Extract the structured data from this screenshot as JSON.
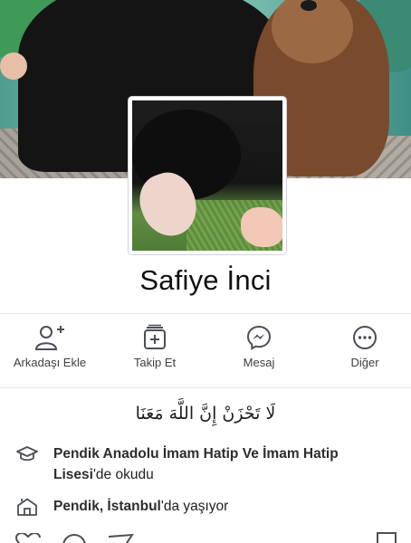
{
  "profile": {
    "name": "Safiye İnci"
  },
  "actions": [
    {
      "label": "Arkadaşı Ekle",
      "icon": "add-friend-icon"
    },
    {
      "label": "Takip Et",
      "icon": "follow-icon"
    },
    {
      "label": "Mesaj",
      "icon": "messenger-icon"
    },
    {
      "label": "Diğer",
      "icon": "more-icon"
    }
  ],
  "bio": "لَا تَحْزَنْ إِنَّ اللَّهَ مَعَنَا",
  "info": {
    "education": {
      "icon": "graduation-cap-icon",
      "school": "Pendik Anadolu İmam Hatip Ve İmam Hatip Lisesi",
      "suffix": "'de okudu"
    },
    "location": {
      "icon": "home-icon",
      "place": "Pendik, İstanbul",
      "suffix": "'da yaşıyor"
    }
  },
  "colors": {
    "icon_stroke": "#4b4f56",
    "divider": "#e4e6eb",
    "text": "#1c1e21"
  }
}
